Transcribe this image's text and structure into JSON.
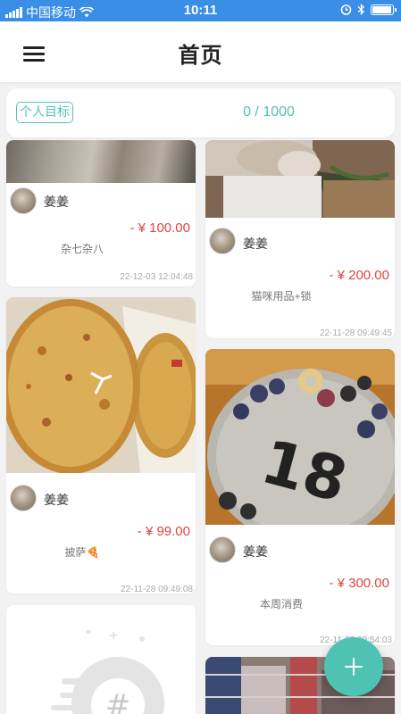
{
  "status_bar": {
    "carrier": "中国移动",
    "time": "10:11",
    "signal_icon": "signal-icon",
    "wifi_icon": "wifi-icon",
    "alarm_icon": "alarm-icon",
    "bluetooth_icon": "bluetooth-icon",
    "battery_icon": "battery-icon",
    "battery_level": 0.95
  },
  "header": {
    "title": "首页",
    "menu_icon": "menu-icon"
  },
  "goal": {
    "tag": "个人目标",
    "value": "0 / 1000"
  },
  "feed": {
    "left": [
      {
        "user": "姜姜",
        "amount": "- ¥ 100.00",
        "desc": "杂七杂八",
        "time": "22-12-03 12:04:48",
        "image": "blurred-person-photo"
      },
      {
        "user": "姜姜",
        "amount": "- ¥ 99.00",
        "desc": "披萨🍕",
        "time": "22-11-28 09:49:08",
        "image": "pizza-photo"
      },
      {
        "image": "empty-placeholder-illustration"
      }
    ],
    "right": [
      {
        "user": "姜姜",
        "amount": "- ¥ 200.00",
        "desc": "猫咪用品+锁",
        "time": "22-11-28 09:49:45",
        "image": "cat-photo"
      },
      {
        "user": "姜姜",
        "amount": "- ¥ 300.00",
        "desc": "本周消费",
        "time": "22-11-28 09:54:03",
        "image": "birthday-cake-photo"
      },
      {
        "image": "store-photo"
      }
    ]
  },
  "fab": {
    "icon": "plus-icon"
  },
  "colors": {
    "accent": "#4fc3b3",
    "amount": "#e0433f",
    "status_bar": "#3a8ee6"
  }
}
